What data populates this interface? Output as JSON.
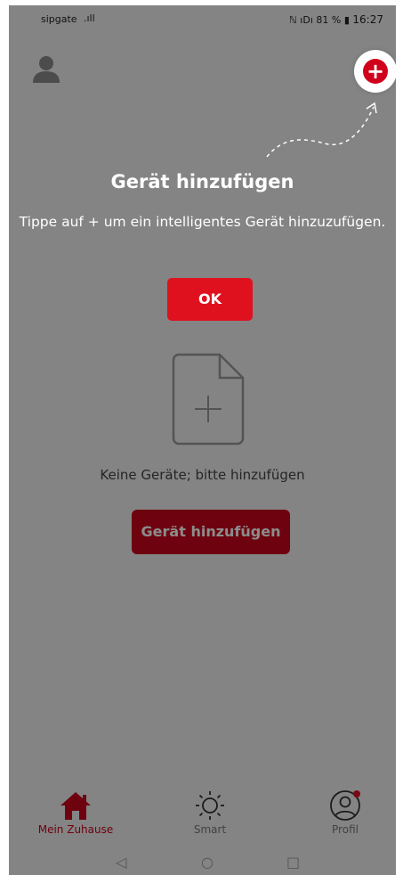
{
  "status_bar": {
    "carrier": "sipgate",
    "signal": ".ıll",
    "right": "ℕ ıDı 81 %",
    "time": "16:27"
  },
  "header": {
    "profile_icon": "person-icon",
    "add_icon": "plus-circle-icon"
  },
  "coachmark": {
    "title": "Gerät hinzufügen",
    "text": "Tippe auf + um ein intelligentes Gerät hinzuzufügen.",
    "ok_label": "OK"
  },
  "empty_state": {
    "message": "Keine Geräte; bitte hinzufügen",
    "add_button_label": "Gerät hinzufügen"
  },
  "bottom_nav": {
    "items": [
      {
        "label": "Mein Zuhause",
        "icon": "home-icon",
        "active": true
      },
      {
        "label": "Smart",
        "icon": "sun-icon",
        "active": false
      },
      {
        "label": "Profil",
        "icon": "user-circle-icon",
        "active": false,
        "badge": true
      }
    ]
  },
  "colors": {
    "accent": "#e0111f",
    "accent_dark": "#c9061c",
    "background": "#f1f1f1"
  }
}
